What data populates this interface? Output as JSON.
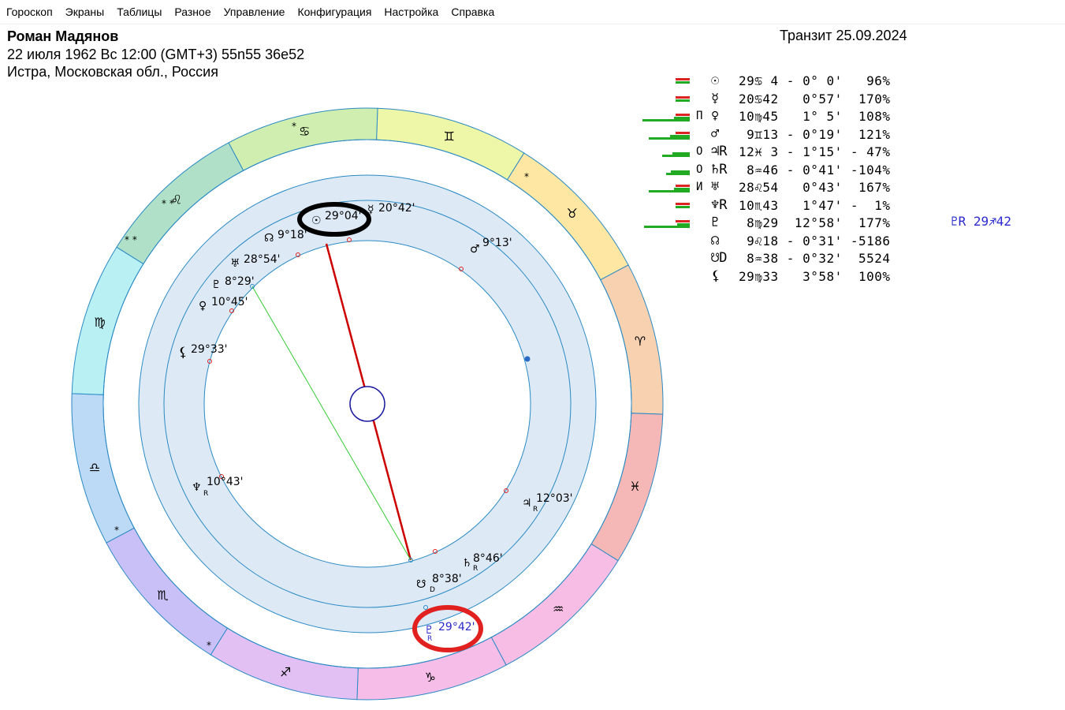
{
  "menu": [
    "Гороскоп",
    "Экраны",
    "Таблицы",
    "Разное",
    "Управление",
    "Конфигурация",
    "Настройка",
    "Справка"
  ],
  "header": {
    "name": "Роман Мадянов",
    "birth_line": "22 июля 1962  Вс  12:00 (GMT+3) 55n55  36e52",
    "place_line": "Истра, Московская обл., Россия",
    "transit": "Транзит 25.09.2024"
  },
  "zodiac": [
    {
      "glyph": "♋",
      "label": "cancer"
    },
    {
      "glyph": "♊",
      "label": "gemini"
    },
    {
      "glyph": "♉",
      "label": "taurus"
    },
    {
      "glyph": "♈",
      "label": "aries"
    },
    {
      "glyph": "♓",
      "label": "pisces"
    },
    {
      "glyph": "♒",
      "label": "aquarius"
    },
    {
      "glyph": "♑",
      "label": "capricorn"
    },
    {
      "glyph": "♐",
      "label": "sagittarius"
    },
    {
      "glyph": "♏",
      "label": "scorpio"
    },
    {
      "glyph": "♎",
      "label": "libra"
    },
    {
      "glyph": "♍",
      "label": "virgo"
    },
    {
      "glyph": "♌",
      "label": "leo"
    }
  ],
  "zodiac_colors": [
    "#cfeeb0",
    "#eef7a8",
    "#fde7a3",
    "#f8d2b0",
    "#f6b8b6",
    "#f7bde4",
    "#f6bde8",
    "#e2c0f4",
    "#c8c0f6",
    "#bcd9f5",
    "#b8f0f4",
    "#b0e0c8"
  ],
  "chart_planets": [
    {
      "glyph": "☉",
      "text": "29°04'",
      "name": "sun"
    },
    {
      "glyph": "☿",
      "text": "20°42'",
      "name": "mercury"
    },
    {
      "glyph": "☊",
      "text": "9°18'",
      "name": "north-node"
    },
    {
      "glyph": "♂",
      "text": "9°13'",
      "name": "mars"
    },
    {
      "glyph": "♅",
      "text": "28°54'",
      "name": "uranus"
    },
    {
      "glyph": "♇",
      "text": "8°29'",
      "name": "pluto"
    },
    {
      "glyph": "♀",
      "text": "10°45'",
      "name": "venus"
    },
    {
      "glyph": "⚸",
      "text": "29°33'",
      "name": "lilith"
    },
    {
      "glyph": "♆",
      "text": "10°43'",
      "name": "neptune",
      "sub": "R"
    },
    {
      "glyph": "♃",
      "text": "12°03'",
      "name": "jupiter",
      "sub": "R"
    },
    {
      "glyph": "♄",
      "text": "8°46'",
      "name": "saturn",
      "sub": "R"
    },
    {
      "glyph": "☋",
      "text": "8°38'",
      "name": "south-node",
      "sub": "D"
    },
    {
      "glyph": "♇",
      "text": "29°42'",
      "name": "transit-pluto",
      "sub": "R"
    }
  ],
  "planet_table": [
    {
      "glyph": "☉",
      "aspect": "",
      "cols": "29♋ 4 - 0° 0'   96%"
    },
    {
      "glyph": "☿",
      "aspect": "",
      "cols": "20♋42   0°57'  170%"
    },
    {
      "glyph": "♀",
      "aspect": "П",
      "cols": "10♍45   1° 5'  108%"
    },
    {
      "glyph": "♂",
      "aspect": "",
      "cols": " 9♊13 - 0°19'  121%"
    },
    {
      "glyph": "♃R",
      "aspect": "О",
      "cols": "12♓ 3 - 1°15' - 47%"
    },
    {
      "glyph": "♄R",
      "aspect": "О",
      "cols": " 8♒46 - 0°41' -104%"
    },
    {
      "glyph": "♅",
      "aspect": "И",
      "cols": "28♌54   0°43'  167%"
    },
    {
      "glyph": "♆R",
      "aspect": "",
      "cols": "10♏43   1°47' -  1%"
    },
    {
      "glyph": "♇",
      "aspect": "",
      "cols": " 8♍29  12°58'  177%"
    },
    {
      "glyph": "☊",
      "aspect": "",
      "cols": " 9♌18 - 0°31' -5186"
    },
    {
      "glyph": "☋D",
      "aspect": "",
      "cols": " 8♒38 - 0°32'  5524"
    },
    {
      "glyph": "⚸",
      "aspect": "",
      "cols": "29♍33   3°58'  100%"
    }
  ],
  "table_extra": "♇R 29♐42",
  "colors": {
    "ring": "#dde9f5",
    "circle": "#2a8ac4",
    "red_mark": "#e0211f",
    "black_mark": "#000000",
    "asc_line": "#cc0000",
    "mc_line": "#33cc33",
    "bar_green": "#22aa22",
    "bar_red": "#dd2222"
  }
}
